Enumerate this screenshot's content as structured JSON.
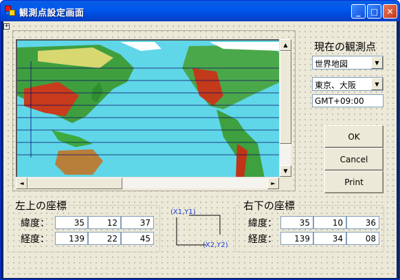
{
  "window": {
    "title": "観測点設定画面"
  },
  "controls": {
    "minimize": "_",
    "maximize": "□",
    "close": "✕"
  },
  "current_section": {
    "label": "現在の観測点"
  },
  "map_select": {
    "value": "世界地図"
  },
  "city_select": {
    "value": "東京、大阪"
  },
  "timezone": {
    "value": "GMT+09:00"
  },
  "buttons": {
    "ok": "OK",
    "cancel": "Cancel",
    "print": "Print"
  },
  "top_left": {
    "title": "左上の座標",
    "lat_label": "緯度：",
    "lon_label": "経度：",
    "lat": [
      "35",
      "12",
      "37"
    ],
    "lon": [
      "139",
      "22",
      "45"
    ]
  },
  "bottom_right": {
    "title": "右下の座標",
    "lat_label": "緯度：",
    "lon_label": "経度：",
    "lat": [
      "35",
      "10",
      "36"
    ],
    "lon": [
      "139",
      "34",
      "08"
    ]
  },
  "diagram": {
    "p1": "(X1,Y1)",
    "p2": "(X2,Y2)"
  },
  "icons": {
    "arrow_down": "▼",
    "arrow_up": "▲",
    "arrow_left": "◄",
    "arrow_right": "►"
  }
}
